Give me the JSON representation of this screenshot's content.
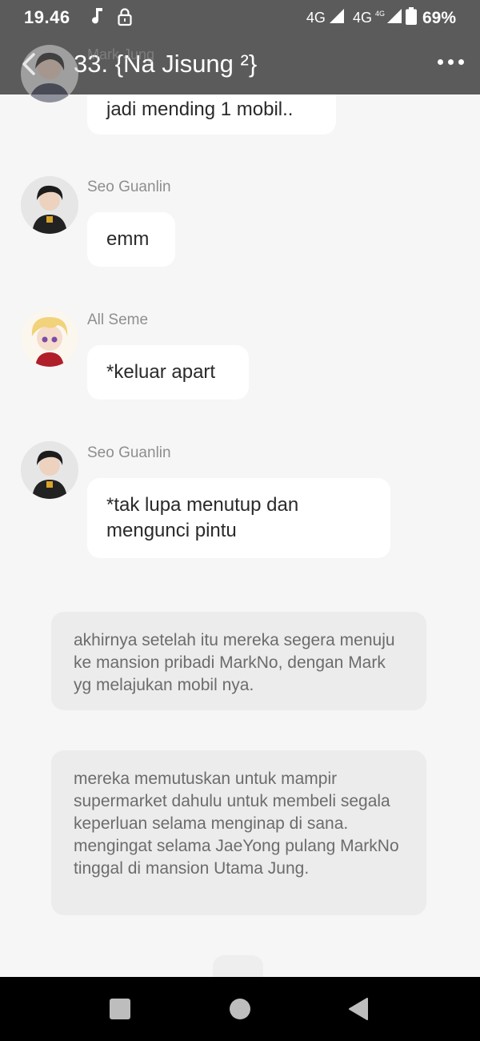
{
  "status_bar": {
    "time": "19.46",
    "network_1": "4G",
    "network_2": "4G",
    "network_2_sup": "4G",
    "battery": "69%"
  },
  "header": {
    "title": "33. {Na Jisung ²}",
    "back_icon": "chevron-left-icon",
    "menu_icon": "more-horizontal-icon"
  },
  "messages": [
    {
      "sender": "Mark Jung",
      "text": "jadi mending 1 mobil.."
    },
    {
      "sender": "Seo Guanlin",
      "text": "emm"
    },
    {
      "sender": "All Seme",
      "text": "*keluar apart"
    },
    {
      "sender": "Seo Guanlin",
      "text": "*tak lupa menutup dan mengunci pintu"
    }
  ],
  "narrations": [
    "akhirnya setelah itu mereka segera menuju ke mansion pribadi MarkNo, dengan Mark yg melajukan mobil nya.",
    "mereka memutuskan untuk mampir supermarket dahulu untuk membeli segala keperluan selama menginap di sana. mengingat selama JaeYong pulang MarkNo tinggal di mansion Utama Jung."
  ],
  "nav_bar": {
    "recent_icon": "square-icon",
    "home_icon": "circle-icon",
    "back_icon": "triangle-back-icon"
  }
}
